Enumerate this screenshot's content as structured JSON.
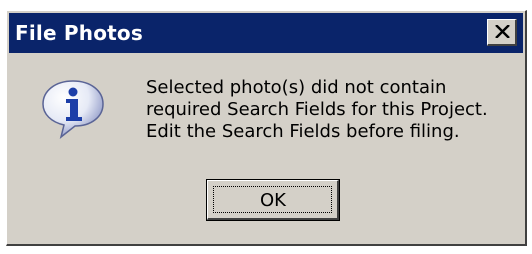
{
  "window": {
    "title": "File Photos",
    "close_icon": "close-icon"
  },
  "content": {
    "icon": "info-icon",
    "message_lines": [
      "Selected photo(s) did not contain",
      "required Search Fields for this Project.",
      "Edit the Search Fields before filing."
    ]
  },
  "buttons": {
    "ok_label": "OK"
  },
  "colors": {
    "titlebar": "#0a246a",
    "face": "#d4d0c8"
  }
}
